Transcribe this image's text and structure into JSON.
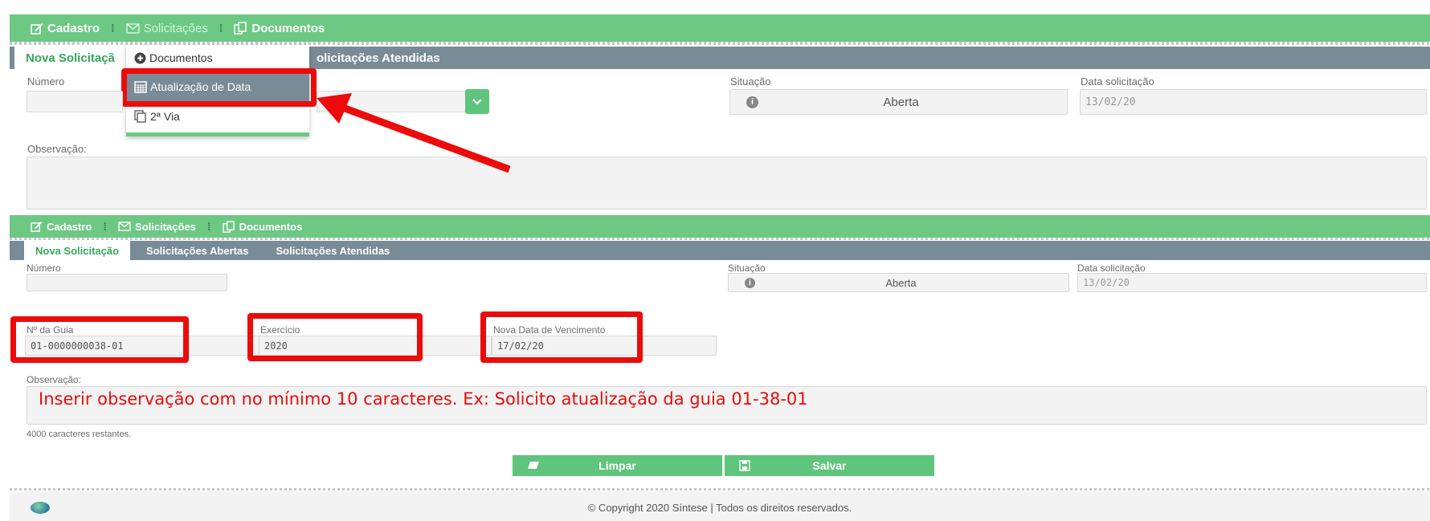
{
  "menu": {
    "items": [
      {
        "label": "Cadastro",
        "icon": "edit-icon"
      },
      {
        "label": "Solicitações",
        "icon": "envelope-icon"
      },
      {
        "label": "Documentos",
        "icon": "documents-icon"
      }
    ]
  },
  "tabs": {
    "new": "Nova Solicitação",
    "open": "Solicitações Abertas",
    "done": "Solicitações Atendidas"
  },
  "top": {
    "tab_new": "Nova Solicitaçã",
    "tab_done": "olicitações Atendidas",
    "dropdown": {
      "header": "Documentos",
      "items": [
        "Atualização de Data",
        "2ª Via"
      ]
    }
  },
  "fields": {
    "numero_label": "Número",
    "situacao_label": "Situação",
    "situacao_value": "Aberta",
    "data_label": "Data solicitação",
    "data_value": "13/02/20",
    "observacao_label": "Observação:",
    "guia_label": "Nº da Guia",
    "guia_value": "01-0000000038-01",
    "exercicio_label": "Exercício",
    "exercicio_value": "2020",
    "vencimento_label": "Nova Data de Vencimento",
    "vencimento_value": "17/02/20",
    "observacao_placeholder": "Inserir observação com no mínimo 10 caracteres. Ex: Solicito atualização da  guia 01-38-01",
    "remaining": "4000 caracteres restantes."
  },
  "buttons": {
    "clear": "Limpar",
    "save": "Salvar"
  },
  "footer": {
    "copyright": "© Copyright 2020 Síntese | Todos os direitos reservados."
  },
  "colors": {
    "accent_green": "#6cc883",
    "tab_gray": "#798b97",
    "annotation_red": "#ec0b0b"
  }
}
